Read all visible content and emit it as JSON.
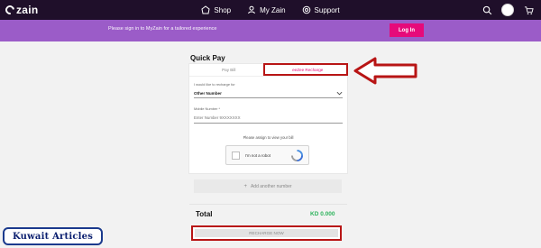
{
  "brand": {
    "logo_text": "zain"
  },
  "nav": {
    "items": [
      {
        "label": "Shop",
        "icon": "shop-icon"
      },
      {
        "label": "My Zain",
        "icon": "user-icon"
      },
      {
        "label": "Support",
        "icon": "support-icon"
      }
    ]
  },
  "banner": {
    "text": "Please sign in to MyZain for a tailored experience",
    "login_label": "Log In"
  },
  "quick_pay": {
    "title": "Quick Pay",
    "tabs": [
      {
        "label": "Pay Bill",
        "active": false
      },
      {
        "label": "eeZee Recharge",
        "active": true
      }
    ],
    "recharge_for": {
      "label": "I would like to recharge for",
      "value": "Other Number"
    },
    "mobile_number": {
      "label": "Mobile Number *",
      "placeholder": "Enter Number 9XXXXXXX"
    },
    "captcha": {
      "hint": "Please assign to view your bill",
      "label": "I'm not a robot"
    },
    "add_another_label": "Add another number"
  },
  "summary": {
    "total_label": "Total",
    "total_value": "KD 0.000",
    "recharge_label": "RECHARGE NOW"
  },
  "watermark": {
    "text": "Kuwait Articles"
  },
  "colors": {
    "topbar": "#1f0f2a",
    "banner": "#9b5cc8",
    "accent": "#e60a7a",
    "highlight": "#b81515",
    "total": "#2db35c"
  }
}
